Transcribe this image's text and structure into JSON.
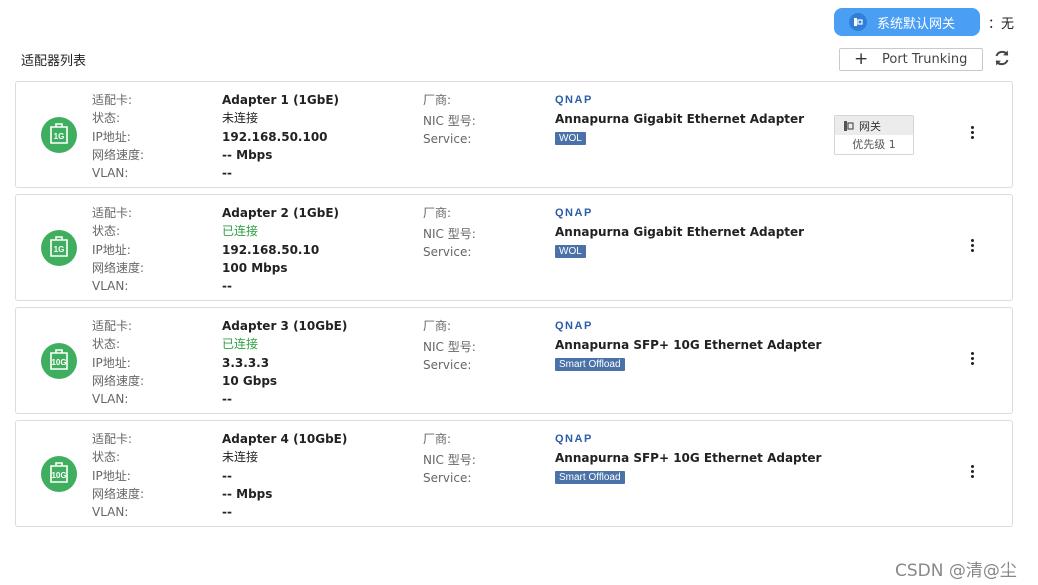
{
  "header": {
    "default_gateway_label": "系统默认网关",
    "default_gateway_value": "：无",
    "section_title": "适配器列表",
    "port_trunking_label": "Port Trunking",
    "port_trunking_icon": "plus-icon",
    "refresh_icon": "refresh-icon"
  },
  "labels": {
    "adapter": "适配卡:",
    "status": "状态:",
    "ip": "IP地址:",
    "speed": "网络速度:",
    "vlan": "VLAN:",
    "vendor": "厂商:",
    "nic_model": "NIC 型号:",
    "service": "Service:"
  },
  "vendor_logo": "QNAP",
  "adapters": [
    {
      "name": "Adapter 1 (1GbE)",
      "status": "未连接",
      "ip": "192.168.50.100",
      "speed": "-- Mbps",
      "vlan": "--",
      "icon_text": "1G",
      "model": "Annapurna Gigabit Ethernet Adapter",
      "service": "WOL",
      "gateway": {
        "label": "网关",
        "priority": "优先级 1"
      }
    },
    {
      "name": "Adapter 2 (1GbE)",
      "status": "已连接",
      "ip": "192.168.50.10",
      "speed": "100 Mbps",
      "vlan": "--",
      "icon_text": "1G",
      "model": "Annapurna Gigabit Ethernet Adapter",
      "service": "WOL"
    },
    {
      "name": "Adapter 3 (10GbE)",
      "status": "已连接",
      "ip": "3.3.3.3",
      "speed": "10 Gbps",
      "vlan": "--",
      "icon_text": "10G",
      "model": "Annapurna SFP+ 10G Ethernet Adapter",
      "service": "Smart Offload"
    },
    {
      "name": "Adapter 4 (10GbE)",
      "status": "未连接",
      "ip": "--",
      "speed": "-- Mbps",
      "vlan": "--",
      "icon_text": "10G",
      "model": "Annapurna SFP+ 10G Ethernet Adapter",
      "service": "Smart Offload"
    }
  ],
  "colors": {
    "accent_blue": "#4a9ff5",
    "status_connected": "#2ea043",
    "nic_icon_green": "#3fae5f",
    "badge_blue": "#4a72a8",
    "qnap_blue": "#2a5ea8"
  },
  "watermark": "CSDN @清@尘"
}
